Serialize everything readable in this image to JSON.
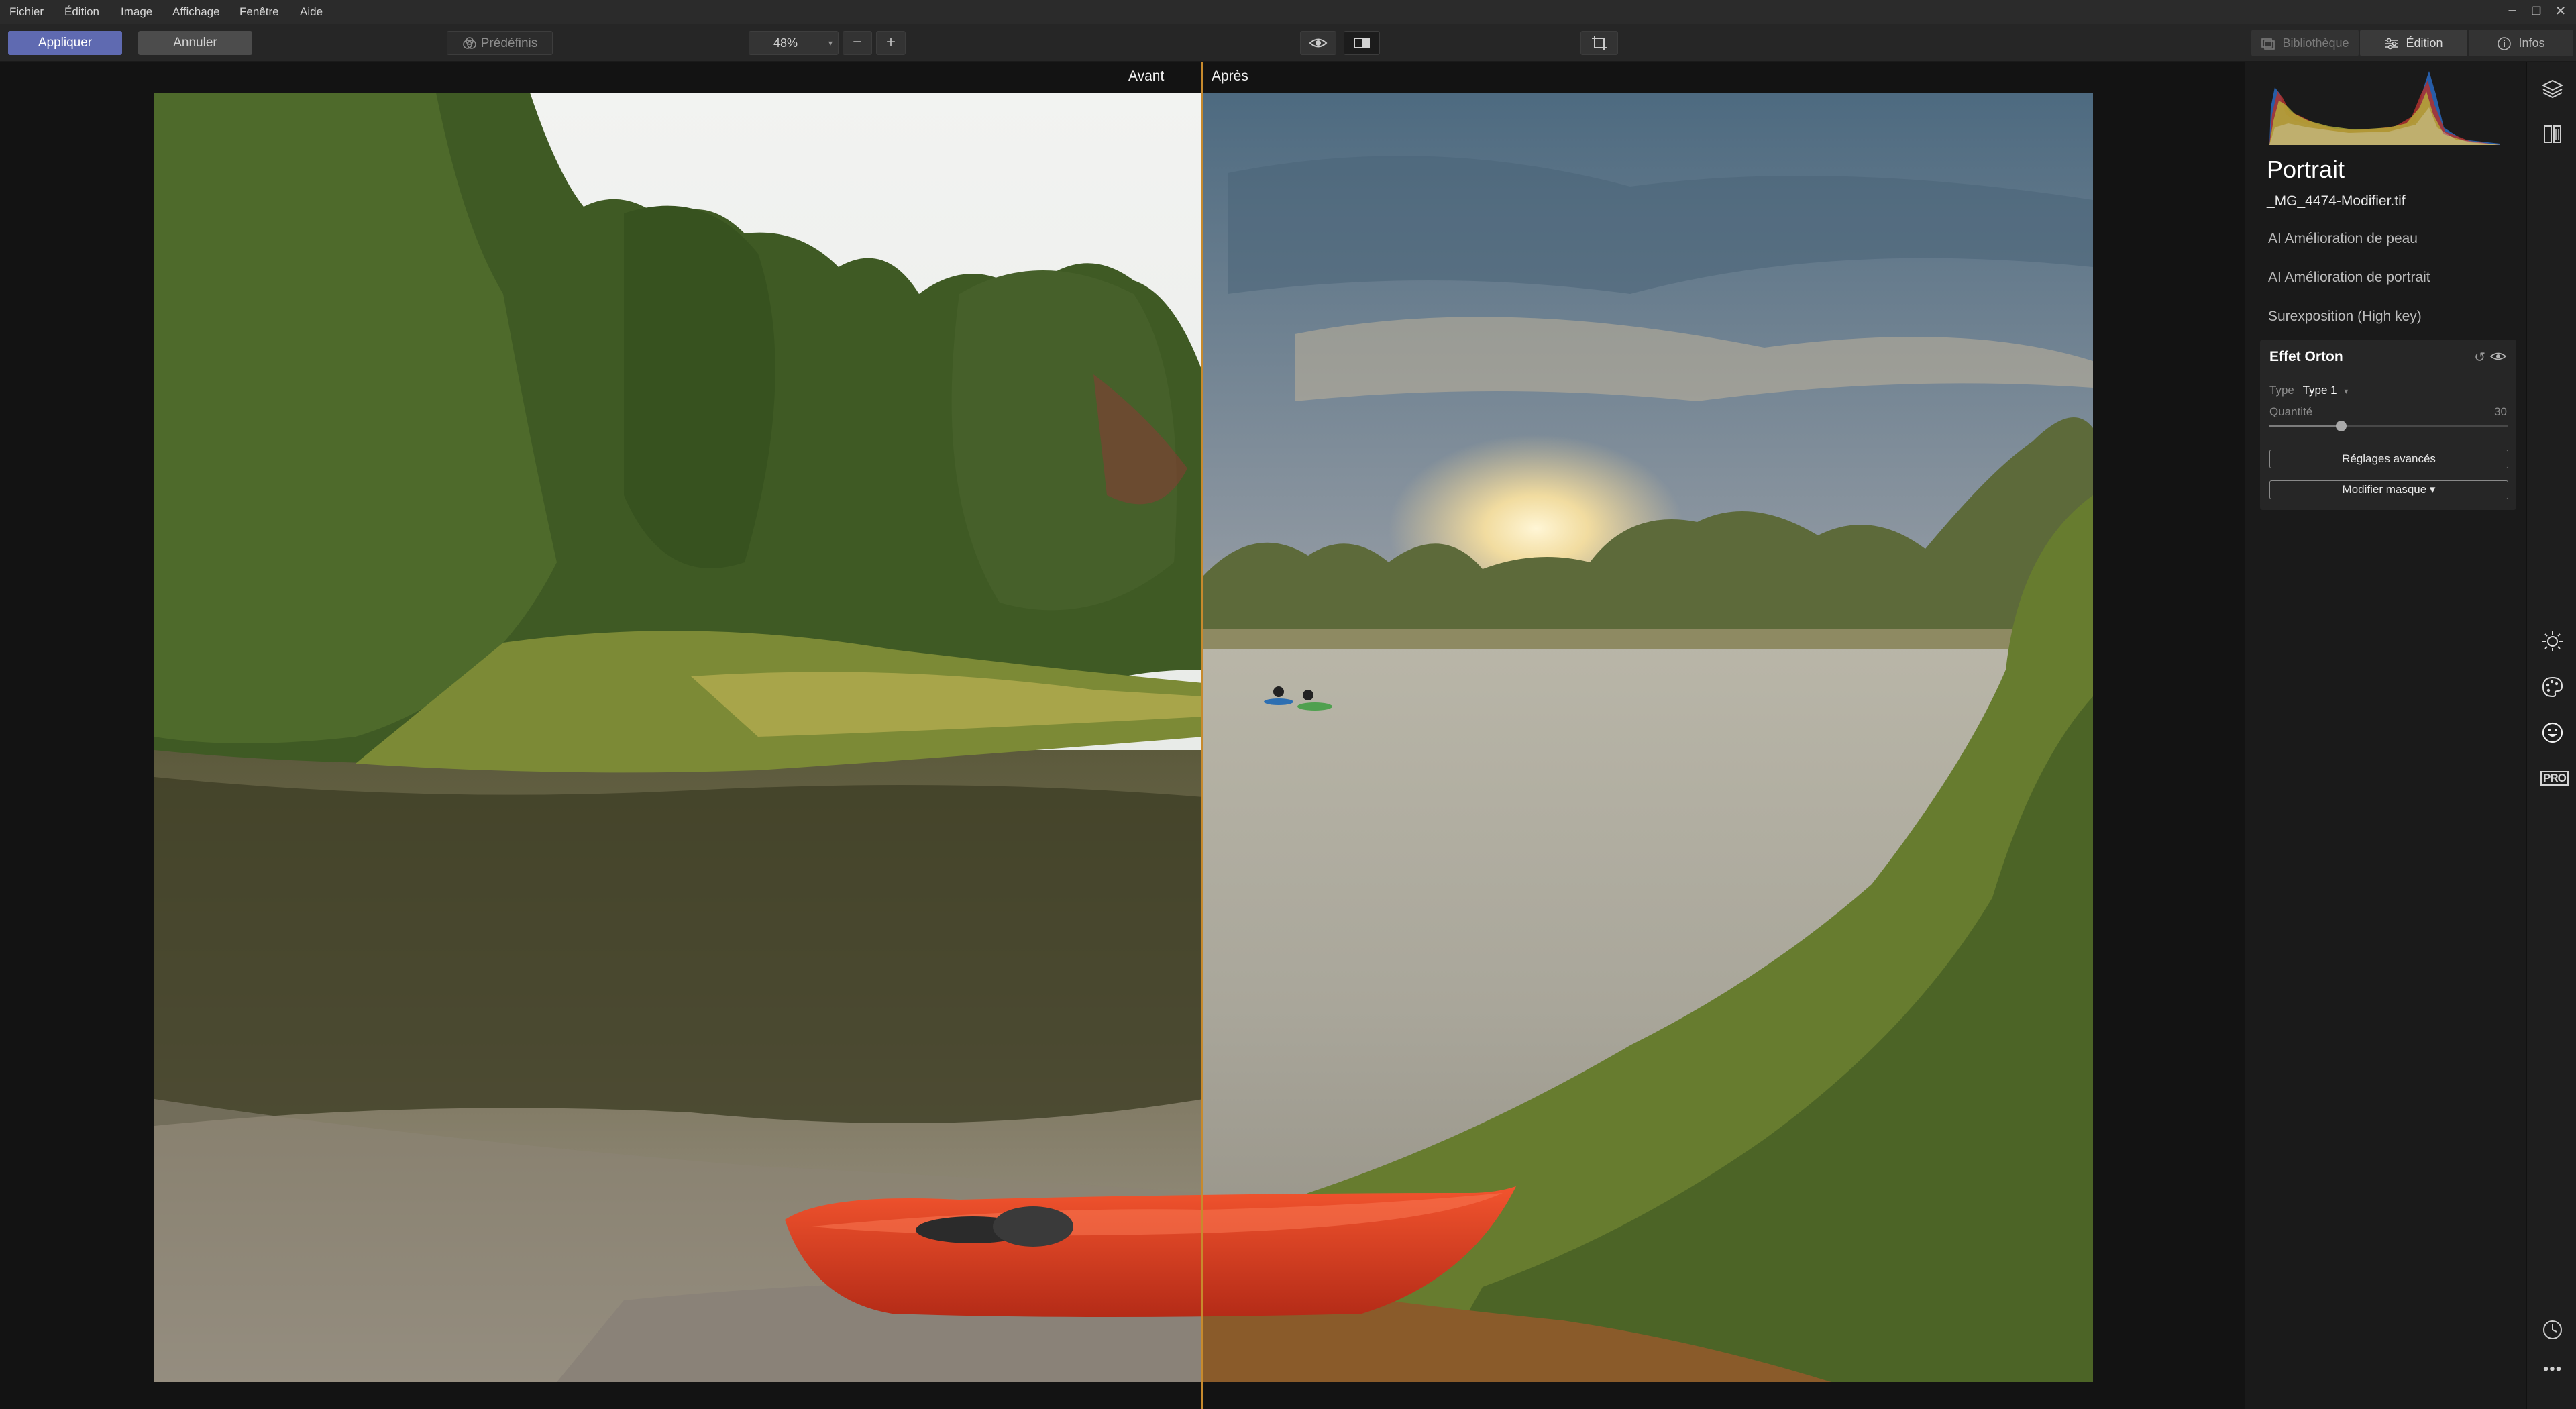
{
  "menu": {
    "items": [
      "Fichier",
      "Édition",
      "Image",
      "Affichage",
      "Fenêtre",
      "Aide"
    ]
  },
  "toolbar": {
    "apply_label": "Appliquer",
    "cancel_label": "Annuler",
    "presets_label": "Prédéfinis",
    "zoom_value": "48%",
    "zoom_out_icon": "minus-icon",
    "zoom_in_icon": "plus-icon"
  },
  "top_tabs": {
    "library_label": "Bibliothèque",
    "edit_label": "Édition",
    "info_label": "Infos"
  },
  "compare": {
    "before_label": "Avant",
    "after_label": "Après"
  },
  "panel": {
    "title": "Portrait",
    "file_name": "_MG_4474-Modifier.tif",
    "tools": [
      "AI Amélioration de peau",
      "AI Amélioration de portrait",
      "Surexposition (High key)"
    ],
    "active_tool": {
      "title": "Effet Orton",
      "type_label": "Type",
      "type_value": "Type 1",
      "quantity_label": "Quantité",
      "quantity_value": "30",
      "quantity_fraction": 0.3,
      "advanced_label": "Réglages avancés",
      "mask_label": "Modifier masque ▾"
    }
  },
  "colors": {
    "accent": "#5f6ab1",
    "split_handle": "#c78a2d"
  },
  "rail_icons": [
    "layers-icon",
    "compare-icon",
    "light-icon",
    "palette-icon",
    "face-icon",
    "pro-icon",
    "history-icon",
    "more-icon"
  ]
}
